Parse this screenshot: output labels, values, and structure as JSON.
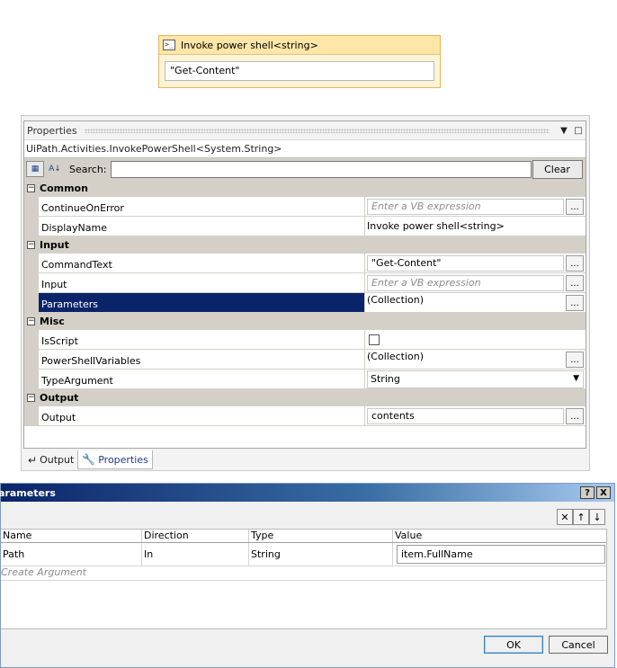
{
  "activity": {
    "icon": "powershell-icon",
    "title": "Invoke power shell<string>",
    "command_value": "\"Get-Content\""
  },
  "properties": {
    "panel_title": "Properties",
    "type_name": "UiPath.Activities.InvokePowerShell<System.String>",
    "search_label": "Search:",
    "search_value": "",
    "clear_label": "Clear",
    "categories": {
      "common": "Common",
      "input": "Input",
      "misc": "Misc",
      "output": "Output"
    },
    "rows": {
      "continue_on_error": {
        "name": "ContinueOnError",
        "placeholder": "Enter a VB expression"
      },
      "display_name": {
        "name": "DisplayName",
        "value": "Invoke power shell<string>"
      },
      "command_text": {
        "name": "CommandText",
        "value": "\"Get-Content\""
      },
      "input": {
        "name": "Input",
        "placeholder": "Enter a VB expression"
      },
      "parameters": {
        "name": "Parameters",
        "value": "(Collection)"
      },
      "is_script": {
        "name": "IsScript",
        "checked": false
      },
      "powershell_variables": {
        "name": "PowerShellVariables",
        "value": "(Collection)"
      },
      "type_argument": {
        "name": "TypeArgument",
        "value": "String"
      },
      "output": {
        "name": "Output",
        "value": "contents"
      }
    },
    "ellipsis": "...",
    "selected_row": "Parameters"
  },
  "bottom_tabs": [
    {
      "label": "Output",
      "active": false
    },
    {
      "label": "Properties",
      "active": true
    }
  ],
  "dialog": {
    "title": "arameters",
    "help_label": "?",
    "close_label": "X",
    "toolbar": {
      "delete": "✕",
      "up": "↑",
      "down": "↓"
    },
    "columns": [
      "Name",
      "Direction",
      "Type",
      "Value"
    ],
    "rows": [
      {
        "name": "Path",
        "direction": "In",
        "type": "String",
        "value": "item.FullName"
      }
    ],
    "create_argument": "Create Argument",
    "ok_label": "OK",
    "cancel_label": "Cancel"
  }
}
